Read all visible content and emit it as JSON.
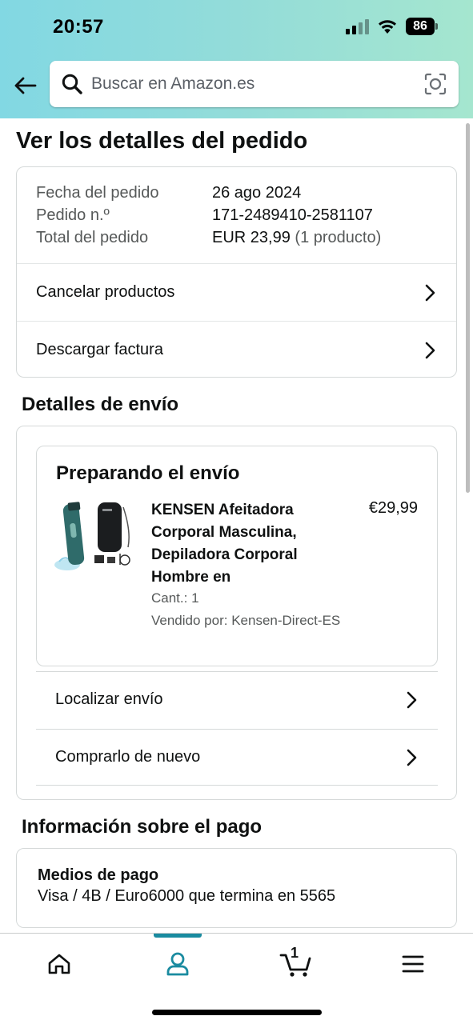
{
  "status_bar": {
    "time": "20:57",
    "battery": "86"
  },
  "search": {
    "placeholder": "Buscar en Amazon.es"
  },
  "page": {
    "title": "Ver los detalles del pedido"
  },
  "order_summary": {
    "date_label": "Fecha del pedido",
    "date_value": "26 ago 2024",
    "number_label": "Pedido n.º",
    "number_value": "171-2489410-2581107",
    "total_label": "Total del pedido",
    "total_value": "EUR 23,99",
    "total_note": "(1 producto)",
    "actions": [
      "Cancelar productos",
      "Descargar factura"
    ]
  },
  "shipping": {
    "section_title": "Detalles de envío",
    "status": "Preparando el envío",
    "product_title": "KENSEN Afeitadora Corporal Masculina, Depiladora Corporal Hombre en",
    "product_price": "€29,99",
    "quantity": "Cant.: 1",
    "seller": "Vendido por: Kensen-Direct-ES",
    "actions": [
      "Localizar envío",
      "Comprarlo de nuevo"
    ]
  },
  "payment": {
    "section_title": "Información sobre el pago",
    "method_title": "Medios de pago",
    "method_value": "Visa / 4B / Euro6000  que termina en 5565"
  },
  "tabbar": {
    "active": "account",
    "cart_count": "1",
    "tabs": [
      "home-icon",
      "account-icon",
      "cart-icon",
      "menu-icon"
    ],
    "accent_color": "#1a8ba0"
  }
}
